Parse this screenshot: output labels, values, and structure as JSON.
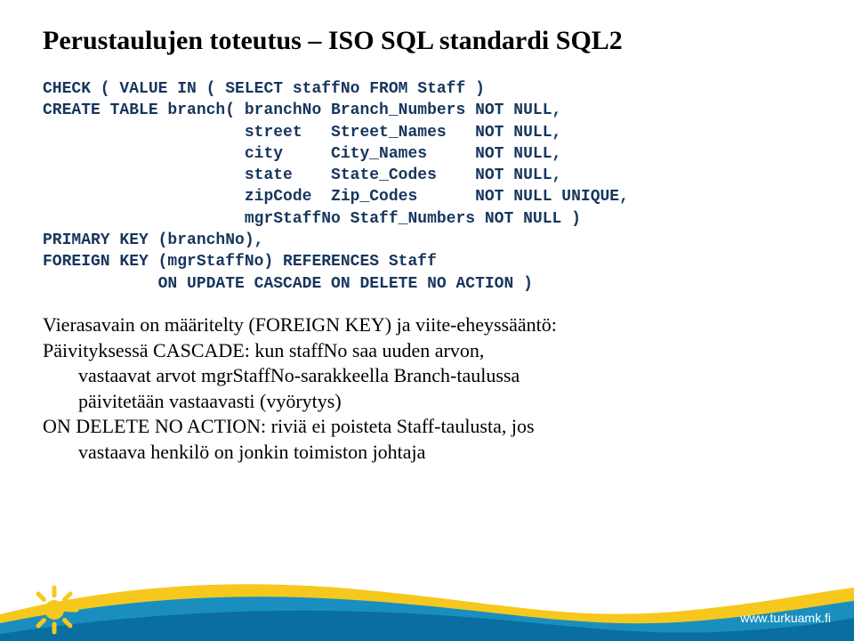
{
  "title": "Perustaulujen toteutus – ISO SQL standardi SQL2",
  "code": "CHECK ( VALUE IN ( SELECT staffNo FROM Staff )\nCREATE TABLE branch( branchNo Branch_Numbers NOT NULL,\n                     street   Street_Names   NOT NULL,\n                     city     City_Names     NOT NULL,\n                     state    State_Codes    NOT NULL,\n                     zipCode  Zip_Codes      NOT NULL UNIQUE,\n                     mgrStaffNo Staff_Numbers NOT NULL )\nPRIMARY KEY (branchNo),\nFOREIGN KEY (mgrStaffNo) REFERENCES Staff\n            ON UPDATE CASCADE ON DELETE NO ACTION )",
  "body": {
    "l1": "Vierasavain on määritelty (FOREIGN KEY) ja viite-eheyssääntö:",
    "l2": "Päivityksessä CASCADE: kun staffNo saa uuden arvon,",
    "l3": "vastaavat arvot mgrStaffNo-sarakkeella Branch-taulussa",
    "l4": "päivitetään vastaavasti (vyörytys)",
    "l5": "ON DELETE NO ACTION: riviä ei poisteta Staff-taulusta, jos",
    "l6": "vastaava henkilö on jonkin toimiston johtaja"
  },
  "footer": {
    "url": "www.turkuamk.fi"
  }
}
